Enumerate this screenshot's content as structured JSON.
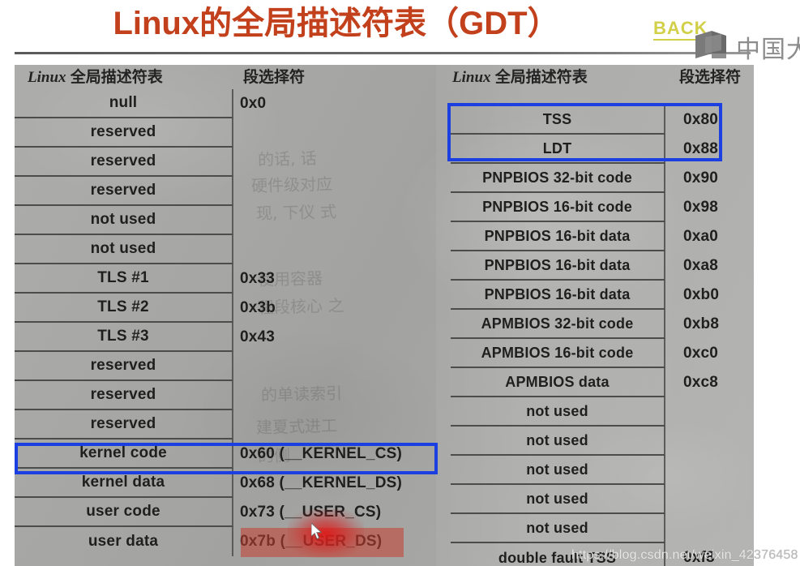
{
  "slide": {
    "title": "Linux的全局描述符表（GDT）",
    "back_link": "BACK",
    "org_logo_text": "中国大",
    "watermark_bright": "https://blog.csdn.net/weixin_42",
    "watermark_dim": "376458"
  },
  "left_table": {
    "header_latin": "Linux",
    "header_cjk": " 全局描述符表",
    "header_selector": "段选择符",
    "rows": [
      {
        "name": "null",
        "selector": "0x0"
      },
      {
        "name": "reserved",
        "selector": ""
      },
      {
        "name": "reserved",
        "selector": ""
      },
      {
        "name": "reserved",
        "selector": ""
      },
      {
        "name": "not used",
        "selector": ""
      },
      {
        "name": "not used",
        "selector": ""
      },
      {
        "name": "TLS #1",
        "selector": "0x33"
      },
      {
        "name": "TLS #2",
        "selector": "0x3b"
      },
      {
        "name": "TLS #3",
        "selector": "0x43"
      },
      {
        "name": "reserved",
        "selector": ""
      },
      {
        "name": "reserved",
        "selector": ""
      },
      {
        "name": "reserved",
        "selector": ""
      },
      {
        "name": "kernel code",
        "selector": "0x60 (__KERNEL_CS)"
      },
      {
        "name": "kernel data",
        "selector": "0x68 (__KERNEL_DS)"
      },
      {
        "name": "user code",
        "selector": "0x73 (__USER_CS)"
      },
      {
        "name": "user data",
        "selector": "0x7b (__USER_DS)"
      }
    ]
  },
  "right_table": {
    "header_latin": "Linux",
    "header_cjk": " 全局描述符表",
    "header_selector": "段选择符",
    "rows": [
      {
        "name": "TSS",
        "selector": "0x80"
      },
      {
        "name": "LDT",
        "selector": "0x88"
      },
      {
        "name": "PNPBIOS 32-bit code",
        "selector": "0x90"
      },
      {
        "name": "PNPBIOS 16-bit code",
        "selector": "0x98"
      },
      {
        "name": "PNPBIOS 16-bit data",
        "selector": "0xa0"
      },
      {
        "name": "PNPBIOS 16-bit data",
        "selector": "0xa8"
      },
      {
        "name": "PNPBIOS 16-bit data",
        "selector": "0xb0"
      },
      {
        "name": "APMBIOS 32-bit code",
        "selector": "0xb8"
      },
      {
        "name": "APMBIOS 16-bit code",
        "selector": "0xc0"
      },
      {
        "name": "APMBIOS data",
        "selector": "0xc8"
      },
      {
        "name": "not used",
        "selector": ""
      },
      {
        "name": "not used",
        "selector": ""
      },
      {
        "name": "not used",
        "selector": ""
      },
      {
        "name": "not used",
        "selector": ""
      },
      {
        "name": "not used",
        "selector": ""
      },
      {
        "name": "double fault TSS",
        "selector": "0xf8"
      }
    ]
  },
  "annotations": {
    "blue_box_color": "#1b3fe0",
    "red_highlight_color": "#c53e2e",
    "title_color": "#c2401b",
    "back_link_color": "#d2cf49",
    "blue_box_left_target": "kernel code",
    "blue_box_right_targets": "TSS / LDT",
    "red_highlight_target": "0x7b (__USER_DS)"
  }
}
